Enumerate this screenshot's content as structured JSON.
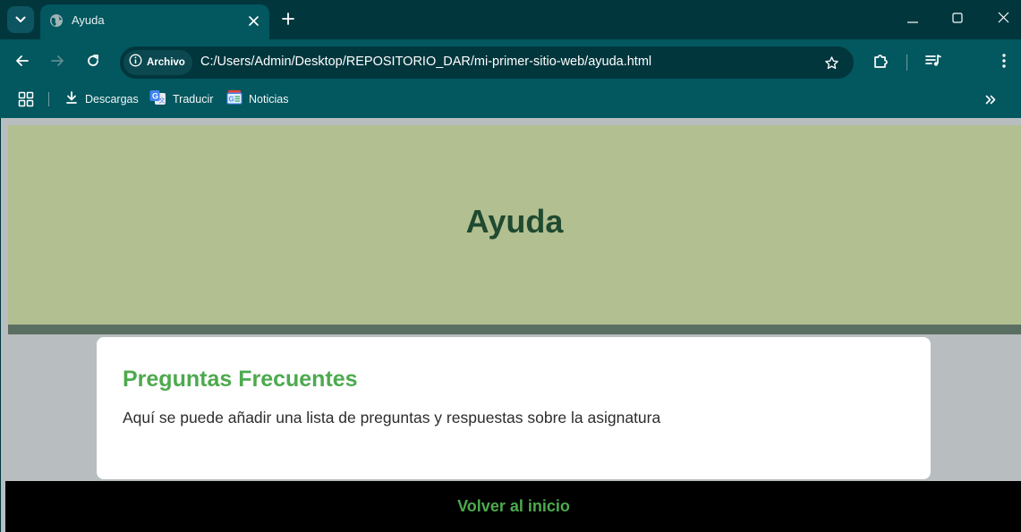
{
  "tab": {
    "title": "Ayuda"
  },
  "omnibox": {
    "site_chip": "Archivo",
    "url": "C:/Users/Admin/Desktop/REPOSITORIO_DAR/mi-primer-sitio-web/ayuda.html"
  },
  "bookmarks": {
    "items": [
      {
        "label": "Descargas",
        "icon": "download-icon"
      },
      {
        "label": "Traducir",
        "icon": "google-translate-icon"
      },
      {
        "label": "Noticias",
        "icon": "google-news-icon"
      }
    ]
  },
  "page": {
    "header_title": "Ayuda",
    "section_heading": "Preguntas Frecuentes",
    "section_text": "Aquí se puede añadir una lista de preguntas y respuestas sobre la asignatura",
    "footer_link": "Volver al inicio"
  },
  "colors": {
    "browser_frame": "#01363d",
    "browser_toolbar": "#03575f",
    "page_background": "#b8bdbf",
    "header_background": "#b2bf91",
    "header_border": "#5a6e62",
    "title_color": "#1f4a30",
    "accent_green": "#4daa4e",
    "footer_background": "#000000"
  }
}
